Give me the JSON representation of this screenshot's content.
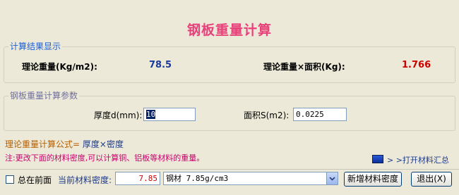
{
  "window": {
    "title": "钢板重量计算"
  },
  "results": {
    "legend": "计算结果显示",
    "unit_weight_label": "理论重量(Kg/m2):",
    "unit_weight_value": "78.5",
    "total_weight_label": "理论重量×面积(Kg):",
    "total_weight_value": "1.766"
  },
  "params": {
    "legend": "钢板重量计算参数",
    "thickness_label": "厚度d(mm):",
    "thickness_value": "10",
    "area_label": "面积S(m2):",
    "area_value": "0.0225"
  },
  "formula": {
    "label": "理论重量计算公式=",
    "value": "厚度×密度"
  },
  "note": "注:更改下面的材料密度,可以计算铜、铝板等材料的重量。",
  "open_materials": "> >打开材料汇总",
  "bottom": {
    "always_on_top_label": "总在前面",
    "always_on_top_checked": false,
    "density_label": "当前材料密度:",
    "density_value": "7.85",
    "material_selected": "钢材 7.85g/cm3",
    "add_density_button": "新增材料密度",
    "exit_button": "退出(X)"
  },
  "colors": {
    "title": "#e8407a",
    "result_value": "#1a3aa0",
    "total_value": "#cc0000",
    "formula_label": "#b86000",
    "note": "#c8006e"
  }
}
